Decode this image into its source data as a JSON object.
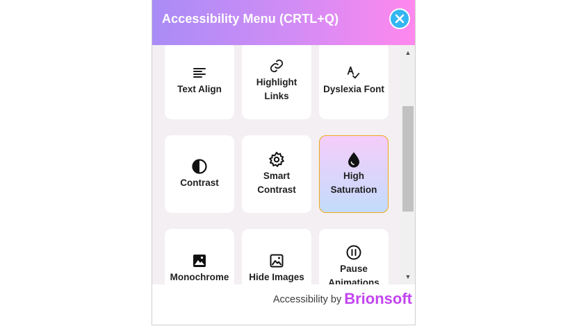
{
  "header": {
    "title": "Accessibility Menu (CRTL+Q)"
  },
  "close": {
    "icon": "close-icon"
  },
  "tiles": [
    {
      "label": "Text Align",
      "icon": "align-left-icon"
    },
    {
      "label": "Highlight Links",
      "icon": "link-icon"
    },
    {
      "label": "Dyslexia Font",
      "icon": "spellcheck-icon"
    },
    {
      "label": "Contrast",
      "icon": "contrast-icon"
    },
    {
      "label": "Smart Contrast",
      "icon": "gear-icon"
    },
    {
      "label": "High Saturation",
      "icon": "droplet-icon",
      "active": true
    },
    {
      "label": "Monochrome",
      "icon": "image-icon"
    },
    {
      "label": "Hide Images",
      "icon": "image-icon"
    },
    {
      "label": "Pause Animations",
      "icon": "pause-circle-icon"
    }
  ],
  "footer": {
    "prefix": "Accessibility by",
    "brand": "Brionsoft"
  },
  "colors": {
    "accent": "#33b6f2",
    "brand": "#c244f0",
    "active_border": "#f0a818"
  }
}
